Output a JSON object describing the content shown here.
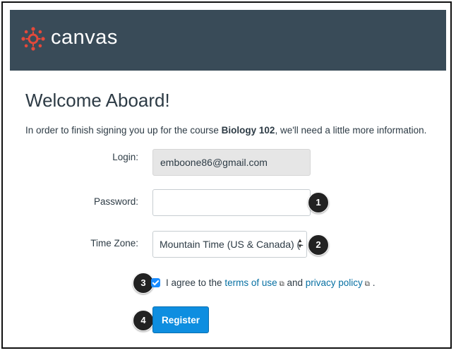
{
  "header": {
    "brand": "canvas",
    "logo_icon": "canvas-logo-icon",
    "bg_color": "#394b58"
  },
  "page": {
    "title": "Welcome Aboard!",
    "intro_prefix": "In order to finish signing you up for the course ",
    "course_name": "Biology 102",
    "intro_suffix": ", we'll need a little more information."
  },
  "form": {
    "login_label": "Login:",
    "login_value": "emboone86@gmail.com",
    "password_label": "Password:",
    "password_value": "",
    "timezone_label": "Time Zone:",
    "timezone_value": "Mountain Time (US & Canada) (-",
    "agree_prefix": "I agree to the ",
    "terms_link": "terms of use",
    "and_text": " and ",
    "privacy_link": "privacy policy",
    "agree_suffix": " .",
    "agree_checked": true,
    "register_label": "Register"
  },
  "callouts": [
    "1",
    "2",
    "3",
    "4"
  ],
  "colors": {
    "accent": "#0e8ee0",
    "link": "#0770a3",
    "checkbox": "#1a8cff"
  }
}
